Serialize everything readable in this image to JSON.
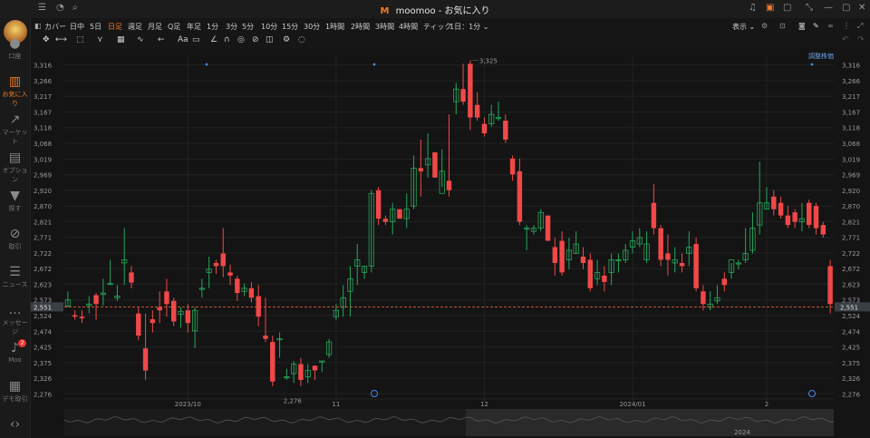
{
  "titlebar": {
    "logo": "M",
    "title": "moomoo - お気に入り"
  },
  "sidebar": {
    "items": [
      {
        "label": "口座",
        "icon": "person-icon",
        "active": false
      },
      {
        "label": "お気に入り",
        "icon": "bar-chart-icon",
        "active": true
      },
      {
        "label": "マーケット",
        "icon": "trend-icon",
        "active": false
      },
      {
        "label": "オプション",
        "icon": "options-icon",
        "active": false
      },
      {
        "label": "探す",
        "icon": "filter-icon",
        "active": false
      },
      {
        "label": "取引",
        "icon": "trade-icon",
        "active": false
      },
      {
        "label": "ニュース",
        "icon": "news-icon",
        "active": false
      },
      {
        "label": "メッセージ",
        "icon": "message-icon",
        "active": false
      },
      {
        "label": "Moo",
        "icon": "moo-icon",
        "active": false,
        "badge": "2"
      },
      {
        "label": "デモ取引",
        "icon": "demo-icon",
        "active": false
      },
      {
        "label": "",
        "icon": "code-icon",
        "active": false
      }
    ]
  },
  "toolbar": {
    "cover": "カバー",
    "timeframes": [
      "日中",
      "5日",
      "日足",
      "週足",
      "月足",
      "Q足",
      "年足",
      "1分",
      "3分",
      "5分",
      "10分",
      "15分",
      "30分",
      "1時間",
      "2時間",
      "3時間",
      "4時間",
      "ティック"
    ],
    "active_timeframe": "日足",
    "range_select": "1日：1分",
    "display": "表示"
  },
  "chart": {
    "adjust_label": "調整株価",
    "high_label": "3,325",
    "low_label": "2,276",
    "last_price": "2,551",
    "y_ticks": [
      "3,316",
      "3,266",
      "3,217",
      "3,167",
      "3,118",
      "3,068",
      "3,019",
      "2,969",
      "2,920",
      "2,870",
      "2,821",
      "2,771",
      "2,722",
      "2,672",
      "2,623",
      "2,573",
      "2,524",
      "2,474",
      "2,425",
      "2,375",
      "2,326",
      "2,276"
    ],
    "x_ticks": [
      {
        "label": "2023/10",
        "c": 17
      },
      {
        "label": "11",
        "c": 38
      },
      {
        "label": "12",
        "c": 59
      },
      {
        "label": "2024/01",
        "c": 80
      },
      {
        "label": "2",
        "c": 99
      }
    ],
    "navigator_year": "2024",
    "colors": {
      "up": "#26a65b",
      "down": "#f04848",
      "bg": "#141414",
      "grid": "#222222",
      "last": "#e05a3a"
    }
  },
  "chart_data": {
    "type": "candlestick",
    "ylim": [
      2251,
      3341
    ],
    "high": 3325,
    "low": 2276,
    "candles": [
      [
        2553,
        2573,
        2550,
        2600
      ],
      [
        2525,
        2520,
        2510,
        2540
      ],
      [
        2520,
        2515,
        2500,
        2540
      ],
      [
        2555,
        2560,
        2530,
        2585
      ],
      [
        2588,
        2560,
        2510,
        2595
      ],
      [
        2590,
        2595,
        2555,
        2640
      ],
      [
        2625,
        2625,
        2620,
        2700
      ],
      [
        2580,
        2585,
        2570,
        2620
      ],
      [
        2690,
        2700,
        2620,
        2800
      ],
      [
        2660,
        2628,
        2610,
        2680
      ],
      [
        2530,
        2460,
        2445,
        2550
      ],
      [
        2420,
        2350,
        2320,
        2530
      ],
      [
        2512,
        2500,
        2470,
        2540
      ],
      [
        2550,
        2540,
        2500,
        2600
      ],
      [
        2600,
        2560,
        2520,
        2640
      ],
      [
        2570,
        2505,
        2490,
        2580
      ],
      [
        2528,
        2537,
        2485,
        2550
      ],
      [
        2540,
        2500,
        2470,
        2560
      ],
      [
        2475,
        2540,
        2420,
        2550
      ],
      [
        2610,
        2610,
        2580,
        2640
      ],
      [
        2660,
        2670,
        2610,
        2710
      ],
      [
        2690,
        2680,
        2655,
        2700
      ],
      [
        2720,
        2680,
        2645,
        2800
      ],
      [
        2660,
        2650,
        2620,
        2685
      ],
      [
        2640,
        2595,
        2570,
        2650
      ],
      [
        2600,
        2610,
        2585,
        2625
      ],
      [
        2610,
        2580,
        2565,
        2630
      ],
      [
        2585,
        2520,
        2490,
        2620
      ],
      [
        2460,
        2450,
        2440,
        2580
      ],
      [
        2440,
        2315,
        2300,
        2460
      ],
      [
        2450,
        2450,
        2390,
        2470
      ],
      [
        2330,
        2330,
        2320,
        2355
      ],
      [
        2340,
        2370,
        2310,
        2380
      ],
      [
        2370,
        2320,
        2300,
        2390
      ],
      [
        2330,
        2350,
        2310,
        2370
      ],
      [
        2365,
        2350,
        2320,
        2365
      ],
      [
        2380,
        2380,
        2345,
        2380
      ],
      [
        2400,
        2440,
        2390,
        2450
      ],
      [
        2520,
        2540,
        2510,
        2560
      ],
      [
        2550,
        2580,
        2520,
        2620
      ],
      [
        2600,
        2640,
        2520,
        2680
      ],
      [
        2680,
        2700,
        2620,
        2750
      ],
      [
        2660,
        2680,
        2640,
        2680
      ],
      [
        2680,
        2910,
        2660,
        2920
      ],
      [
        2920,
        2830,
        2810,
        2930
      ],
      [
        2830,
        2820,
        2810,
        2840
      ],
      [
        2820,
        2860,
        2780,
        2880
      ],
      [
        2860,
        2830,
        2830,
        2860
      ],
      [
        2830,
        2860,
        2800,
        2910
      ],
      [
        2870,
        2990,
        2860,
        3030
      ],
      [
        2990,
        2980,
        2900,
        3080
      ],
      [
        3000,
        3020,
        2960,
        3100
      ],
      [
        3040,
        2960,
        2960,
        3040
      ],
      [
        2910,
        2980,
        2930,
        3050
      ],
      [
        2950,
        2920,
        2900,
        3160
      ],
      [
        3200,
        3240,
        3160,
        3260
      ],
      [
        3240,
        3200,
        3190,
        3320
      ],
      [
        3320,
        3150,
        3110,
        3330
      ],
      [
        3190,
        3150,
        3140,
        3230
      ],
      [
        3130,
        3100,
        3090,
        3150
      ],
      [
        3130,
        3160,
        3120,
        3190
      ],
      [
        3150,
        3150,
        3140,
        3200
      ],
      [
        3140,
        3080,
        3070,
        3160
      ],
      [
        3020,
        2970,
        2950,
        3030
      ],
      [
        2980,
        2820,
        2810,
        3020
      ],
      [
        2800,
        2800,
        2730,
        2810
      ],
      [
        2790,
        2800,
        2780,
        2810
      ],
      [
        2800,
        2850,
        2790,
        2860
      ],
      [
        2840,
        2760,
        2760,
        2840
      ],
      [
        2740,
        2690,
        2650,
        2770
      ],
      [
        2760,
        2660,
        2650,
        2790
      ],
      [
        2700,
        2730,
        2670,
        2770
      ],
      [
        2720,
        2750,
        2720,
        2790
      ],
      [
        2710,
        2690,
        2670,
        2740
      ],
      [
        2700,
        2610,
        2600,
        2720
      ],
      [
        2640,
        2660,
        2620,
        2700
      ],
      [
        2650,
        2630,
        2600,
        2680
      ],
      [
        2660,
        2700,
        2620,
        2720
      ],
      [
        2700,
        2700,
        2660,
        2720
      ],
      [
        2700,
        2730,
        2690,
        2750
      ],
      [
        2740,
        2760,
        2720,
        2790
      ],
      [
        2750,
        2770,
        2740,
        2800
      ],
      [
        2700,
        2750,
        2690,
        2790
      ],
      [
        2880,
        2800,
        2780,
        2940
      ],
      [
        2800,
        2700,
        2680,
        2810
      ],
      [
        2720,
        2700,
        2650,
        2780
      ],
      [
        2690,
        2700,
        2660,
        2740
      ],
      [
        2690,
        2680,
        2660,
        2720
      ],
      [
        2720,
        2740,
        2680,
        2790
      ],
      [
        2750,
        2610,
        2600,
        2770
      ],
      [
        2600,
        2560,
        2540,
        2620
      ],
      [
        2550,
        2560,
        2540,
        2600
      ],
      [
        2570,
        2580,
        2560,
        2620
      ],
      [
        2640,
        2620,
        2600,
        2660
      ],
      [
        2660,
        2700,
        2640,
        2690
      ],
      [
        2690,
        2690,
        2670,
        2700
      ],
      [
        2700,
        2720,
        2690,
        2800
      ],
      [
        2730,
        2800,
        2720,
        2850
      ],
      [
        2810,
        2880,
        2780,
        3010
      ],
      [
        2860,
        2880,
        2860,
        2930
      ],
      [
        2900,
        2860,
        2840,
        2920
      ],
      [
        2880,
        2840,
        2830,
        2900
      ],
      [
        2840,
        2810,
        2800,
        2870
      ],
      [
        2850,
        2820,
        2800,
        2860
      ],
      [
        2820,
        2830,
        2790,
        2880
      ],
      [
        2880,
        2810,
        2800,
        2890
      ],
      [
        2870,
        2800,
        2780,
        2880
      ],
      [
        2810,
        2780,
        2770,
        2820
      ],
      [
        2680,
        2560,
        2530,
        2700
      ]
    ],
    "last_price": 2551
  }
}
